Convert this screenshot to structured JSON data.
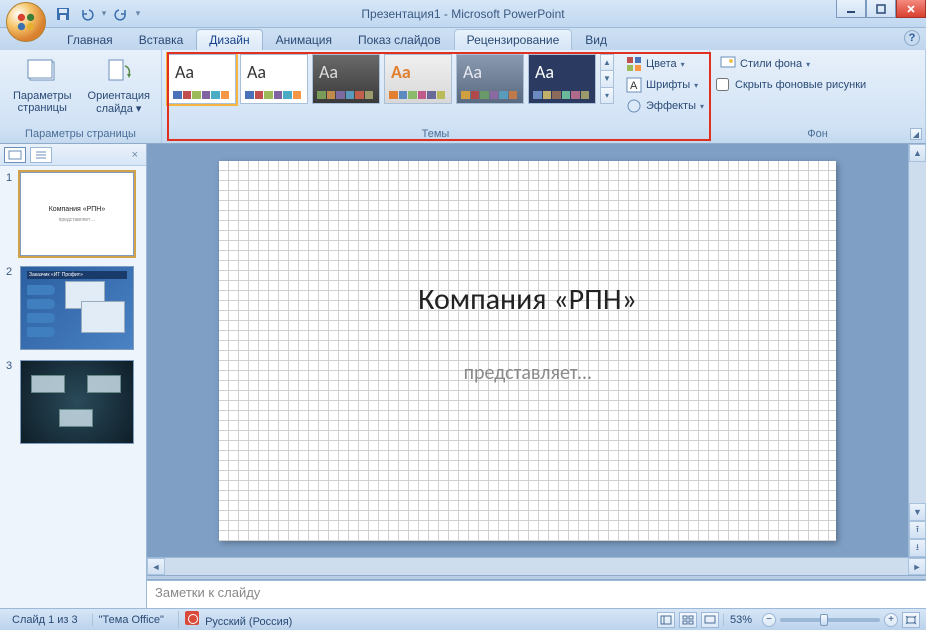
{
  "window": {
    "title": "Презентация1 - Microsoft PowerPoint"
  },
  "tabs": {
    "home": "Главная",
    "insert": "Вставка",
    "design": "Дизайн",
    "animations": "Анимация",
    "slideshow": "Показ слайдов",
    "review": "Рецензирование",
    "view": "Вид"
  },
  "ribbon": {
    "page_setup_group": "Параметры страницы",
    "page_params": "Параметры страницы",
    "orientation": "Ориентация слайда",
    "themes_group": "Темы",
    "colors": "Цвета",
    "fonts": "Шрифты",
    "effects": "Эффекты",
    "background_group": "Фон",
    "bg_styles": "Стили фона",
    "hide_bg_graphics": "Скрыть фоновые рисунки"
  },
  "slide": {
    "title": "Компания «РПН»",
    "subtitle": "представляет…"
  },
  "notes": {
    "placeholder": "Заметки к слайду"
  },
  "status": {
    "slide_counter": "Слайд 1 из 3",
    "theme": "\"Тема Office\"",
    "language": "Русский (Россия)",
    "zoom": "53%"
  },
  "thumbs": {
    "t1_title": "Компания «РПН»",
    "t1_sub": "представляет…"
  }
}
